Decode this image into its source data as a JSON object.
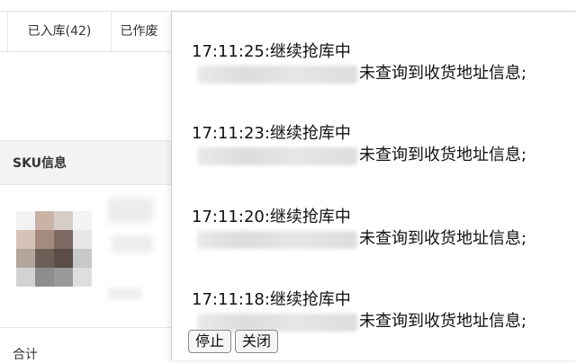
{
  "tabs": [
    {
      "label": ""
    },
    {
      "label": "已入库(42)"
    },
    {
      "label": "已作废"
    }
  ],
  "section": {
    "sku_title": "SKU信息"
  },
  "footer": {
    "total_label": "合计"
  },
  "log": {
    "entries": [
      {
        "time_line": "17:11:25:继续抢库中",
        "message": "未查询到收货地址信息;"
      },
      {
        "time_line": "17:11:23:继续抢库中",
        "message": "未查询到收货地址信息;"
      },
      {
        "time_line": "17:11:20:继续抢库中",
        "message": "未查询到收货地址信息;"
      },
      {
        "time_line": "17:11:18:继续抢库中",
        "message": "未查询到收货地址信息;"
      }
    ]
  },
  "buttons": {
    "stop": "停止",
    "close": "关闭"
  }
}
